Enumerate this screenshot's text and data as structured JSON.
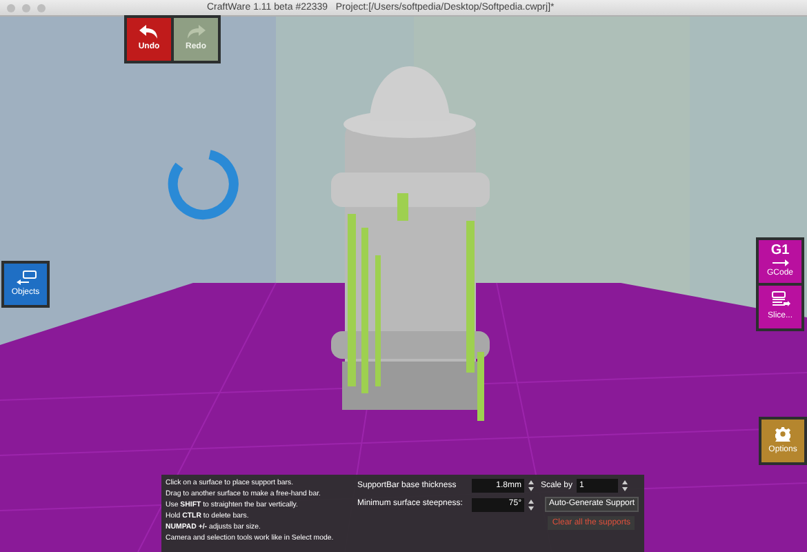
{
  "window": {
    "title": "CraftWare 1.11 beta #22339   Project:[/Users/softpedia/Desktop/Softpedia.cwprj]*"
  },
  "history": [
    {
      "label": "Undo",
      "disabled": false
    },
    {
      "label": "Redo",
      "disabled": true
    }
  ],
  "left_tools": [
    {
      "label": "Objects"
    }
  ],
  "right_tools": [
    {
      "kind": "gcode",
      "glyph": "G1",
      "label": "GCode"
    },
    {
      "kind": "slice",
      "label": "Slice..."
    }
  ],
  "options": {
    "label": "Options"
  },
  "support_panel": {
    "help": [
      "Click on a surface to place support bars.",
      "Drag to another surface to make a free-hand bar.",
      "Use **SHIFT** to straighten the bar vertically.",
      "Hold **CTLR** to delete bars.",
      "**NUMPAD +/-** adjusts bar size.",
      "Camera and selection tools work like in Select mode."
    ],
    "base_thickness": {
      "label": "SupportBar base thickness",
      "value": "1.8mm"
    },
    "scale": {
      "label": "Scale by",
      "value": "1"
    },
    "steepness": {
      "label": "Minimum surface steepness:",
      "value": "75°"
    },
    "buttons": [
      {
        "label": "Auto-Generate Support",
        "kind": "normal"
      },
      {
        "label": "Clear all the supports",
        "kind": "danger"
      }
    ]
  }
}
